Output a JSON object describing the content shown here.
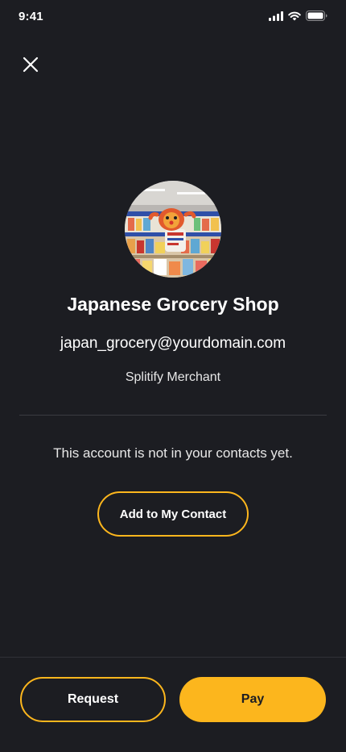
{
  "status_bar": {
    "time": "9:41",
    "icons": [
      "signal-icon",
      "wifi-icon",
      "battery-icon"
    ]
  },
  "header": {
    "close_icon": "close-icon"
  },
  "merchant": {
    "name": "Japanese Grocery Shop",
    "email": "japan_grocery@yourdomain.com",
    "type": "Splitify Merchant"
  },
  "contact": {
    "note": "This account is not in your contacts yet.",
    "add_label": "Add to My Contact"
  },
  "actions": {
    "request_label": "Request",
    "pay_label": "Pay"
  },
  "colors": {
    "background": "#1c1d22",
    "accent": "#fcb61d",
    "text": "#ffffff"
  }
}
